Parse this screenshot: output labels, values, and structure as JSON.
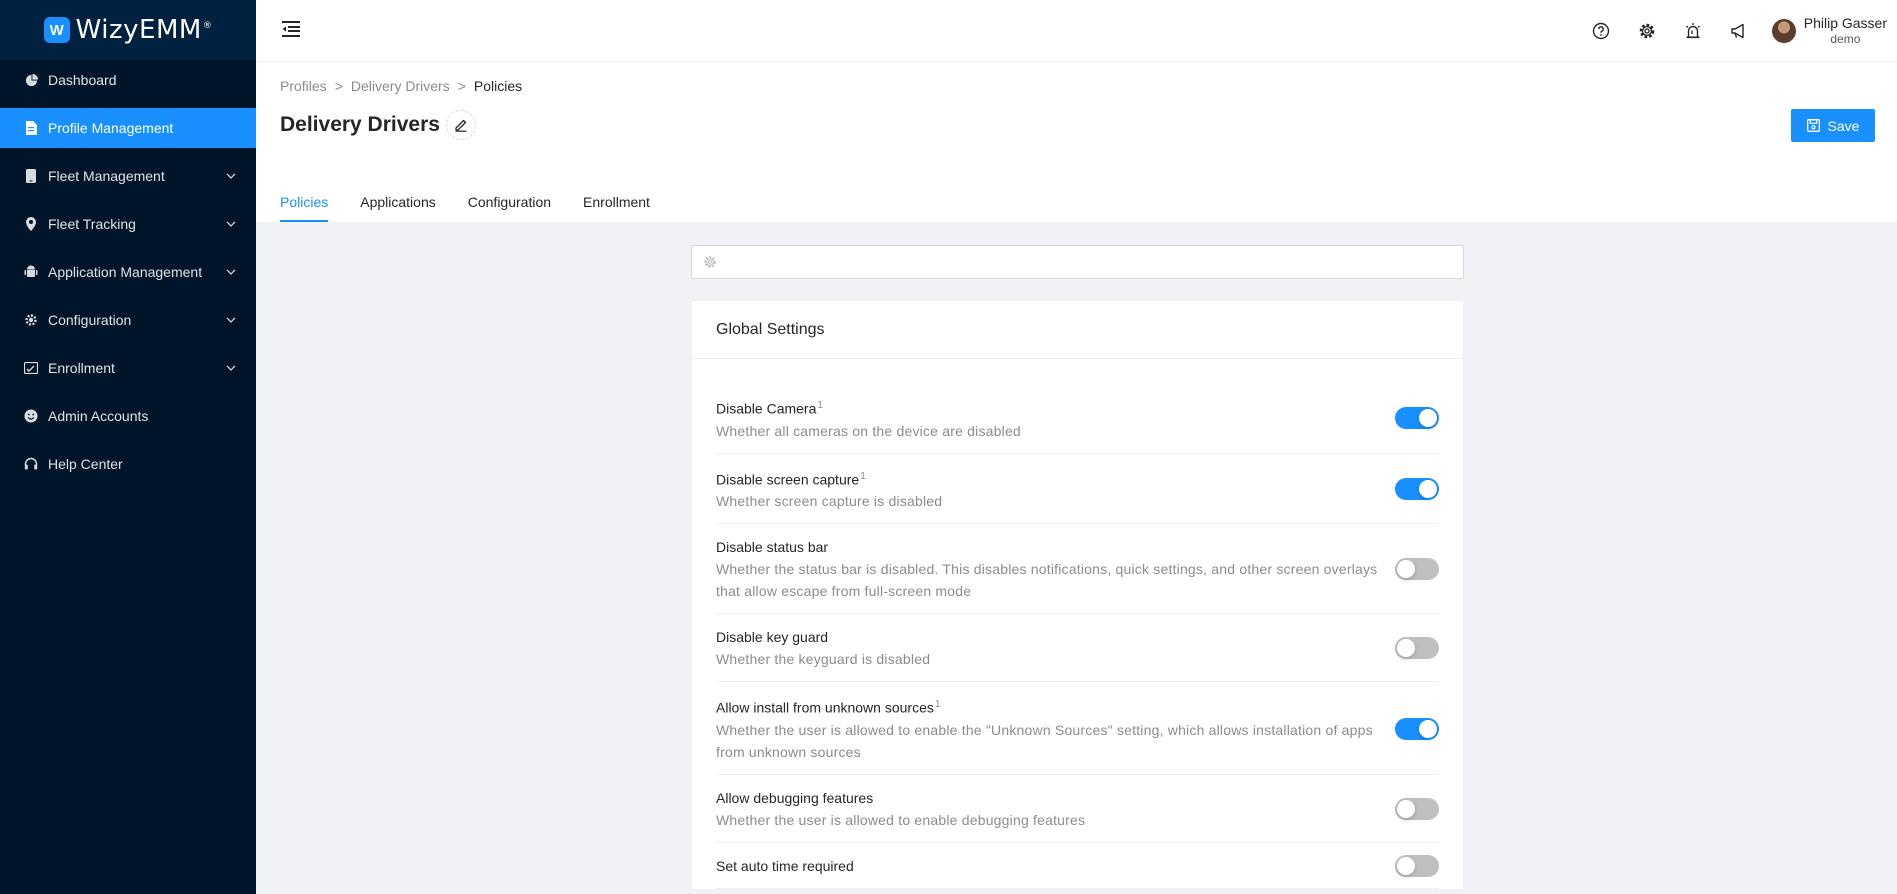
{
  "brand": {
    "name": "WizyEMM",
    "mark": "W",
    "reg": "®"
  },
  "sidebar": {
    "items": [
      {
        "label": "Dashboard",
        "icon": "dashboard-icon",
        "active": false,
        "expandable": false
      },
      {
        "label": "Profile Management",
        "icon": "file-icon",
        "active": true,
        "expandable": false
      },
      {
        "label": "Fleet Management",
        "icon": "mobile-icon",
        "active": false,
        "expandable": true
      },
      {
        "label": "Fleet Tracking",
        "icon": "location-icon",
        "active": false,
        "expandable": true
      },
      {
        "label": "Application Management",
        "icon": "android-icon",
        "active": false,
        "expandable": true
      },
      {
        "label": "Configuration",
        "icon": "gear-icon",
        "active": false,
        "expandable": true
      },
      {
        "label": "Enrollment",
        "icon": "enroll-icon",
        "active": false,
        "expandable": true
      },
      {
        "label": "Admin Accounts",
        "icon": "smile-icon",
        "active": false,
        "expandable": false
      },
      {
        "label": "Help Center",
        "icon": "headset-icon",
        "active": false,
        "expandable": false
      }
    ]
  },
  "header": {
    "user": {
      "name": "Philip Gasser",
      "role": "demo"
    },
    "icons": [
      "help-icon",
      "gear-icon",
      "alarm-icon",
      "announcement-icon"
    ]
  },
  "breadcrumb": {
    "items": [
      "Profiles",
      "Delivery Drivers",
      "Policies"
    ],
    "separator": ">"
  },
  "page": {
    "title": "Delivery Drivers",
    "save_label": "Save"
  },
  "tabs": [
    {
      "label": "Policies",
      "active": true
    },
    {
      "label": "Applications",
      "active": false
    },
    {
      "label": "Configuration",
      "active": false
    },
    {
      "label": "Enrollment",
      "active": false
    }
  ],
  "search": {
    "value": "",
    "placeholder": ""
  },
  "card": {
    "title": "Global Settings",
    "settings": [
      {
        "title": "Disable Camera",
        "sup": "1",
        "desc": "Whether all cameras on the device are disabled",
        "on": true
      },
      {
        "title": "Disable screen capture",
        "sup": "1",
        "desc": "Whether screen capture is disabled",
        "on": true
      },
      {
        "title": "Disable status bar",
        "sup": "",
        "desc": "Whether the status bar is disabled. This disables notifications, quick settings, and other screen overlays that allow escape from full-screen mode",
        "on": false
      },
      {
        "title": "Disable key guard",
        "sup": "",
        "desc": "Whether the keyguard is disabled",
        "on": false
      },
      {
        "title": "Allow install from unknown sources",
        "sup": "1",
        "desc": "Whether the user is allowed to enable the \"Unknown Sources\" setting, which allows installation of apps from unknown sources",
        "on": true
      },
      {
        "title": "Allow debugging features",
        "sup": "",
        "desc": "Whether the user is allowed to enable debugging features",
        "on": false
      },
      {
        "title": "Set auto time required",
        "sup": "",
        "desc": "",
        "on": false
      }
    ]
  },
  "colors": {
    "sidebar_bg": "#001529",
    "accent": "#1890ff",
    "switch_off": "#bfbfbf"
  }
}
